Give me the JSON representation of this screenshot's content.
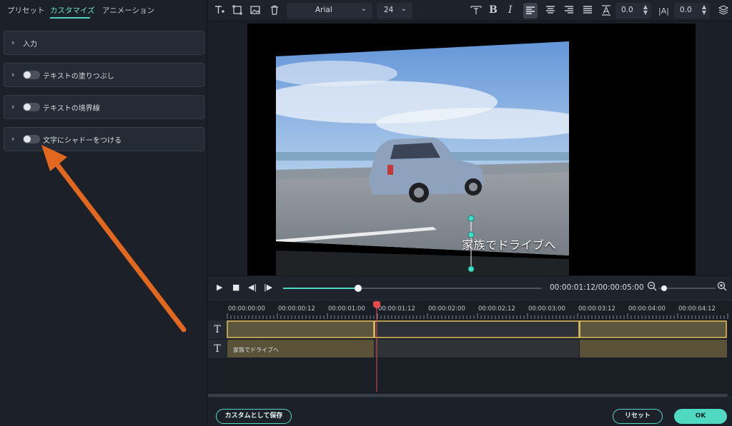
{
  "tabs": [
    {
      "label": "プリセット"
    },
    {
      "label": "カスタマイズ"
    },
    {
      "label": "アニメーション"
    }
  ],
  "sections": [
    {
      "label": "入力",
      "has_toggle": false
    },
    {
      "label": "テキストの塗りつぶし",
      "has_toggle": true
    },
    {
      "label": "テキストの境界線",
      "has_toggle": true
    },
    {
      "label": "文字にシャドーをつける",
      "has_toggle": true
    }
  ],
  "toolbar": {
    "font_family": "Arial",
    "font_size": "24",
    "char_spacing": "0.0",
    "line_spacing": "0.0",
    "icons": [
      "text-add-icon",
      "crop-icon",
      "image-icon",
      "trash-icon",
      "text-size-icon",
      "bold-icon",
      "italic-icon",
      "align-left-icon",
      "align-center-icon",
      "align-right-icon",
      "align-justify-icon",
      "text-baseline-icon",
      "letter-spacing-icon",
      "layers-icon"
    ],
    "bold": "B",
    "italic": "I"
  },
  "preview": {
    "caption": "家族でドライブへ"
  },
  "playback": {
    "timecode": "00:00:01:12/00:00:05:00",
    "progress": 0.29,
    "zoom_level": 0.07
  },
  "timeline": {
    "ruler": [
      "00:00:00:00",
      "00:00:00:12",
      "00:00:01:00",
      "00:00:01:12",
      "00:00:02:00",
      "00:00:02:12",
      "00:00:03:00",
      "00:00:03:12",
      "00:00:04:00",
      "00:00:04:12"
    ],
    "track_icon": "T",
    "clip_text": "家族でドライブへ"
  },
  "footer": {
    "save_custom": "カスタムとして保存",
    "reset": "リセット",
    "ok": "OK"
  },
  "colors": {
    "accent": "#4fd8c2",
    "arrow": "#e2671f",
    "playhead": "#e64a4a",
    "clip_selected": "#e5c15a"
  }
}
